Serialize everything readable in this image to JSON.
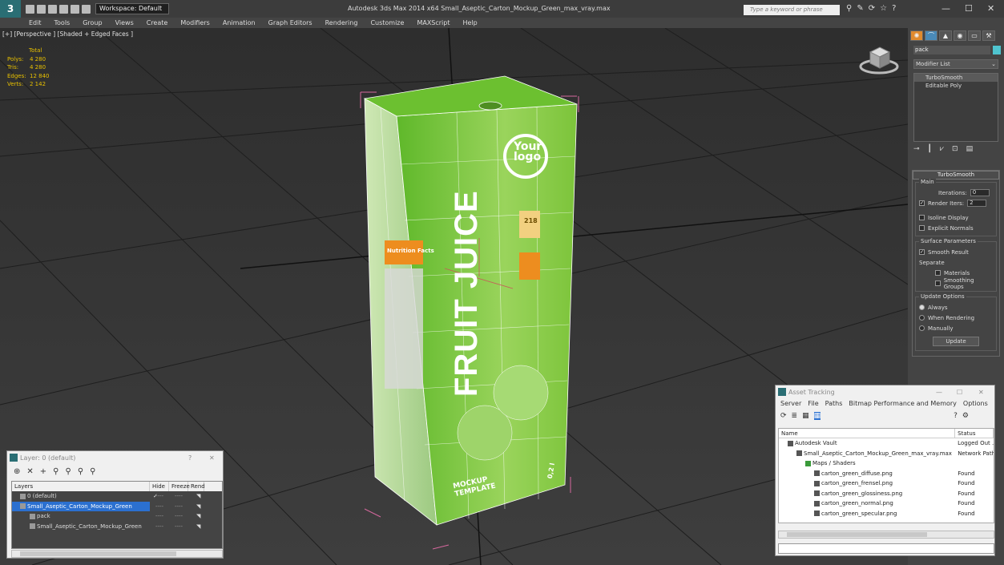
{
  "app": {
    "logo": "3",
    "workspace": "Workspace: Default",
    "title": "Autodesk 3ds Max  2014 x64     Small_Aseptic_Carton_Mockup_Green_max_vray.max",
    "search_placeholder": "Type a keyword or phrase"
  },
  "menu": [
    "Edit",
    "Tools",
    "Group",
    "Views",
    "Create",
    "Modifiers",
    "Animation",
    "Graph Editors",
    "Rendering",
    "Customize",
    "MAXScript",
    "Help"
  ],
  "viewport": {
    "label": "[+] [Perspective ] [Shaded + Edged Faces ]",
    "stats_header": "Total",
    "stats": [
      {
        "k": "Polys:",
        "v": "4 280"
      },
      {
        "k": "Tris:",
        "v": "4 280"
      },
      {
        "k": "Edges:",
        "v": "12 840"
      },
      {
        "k": "Verts:",
        "v": "2 142"
      }
    ],
    "carton": {
      "brand_text": "FRUIT JUICE",
      "logo_line1": "Your",
      "logo_line2": "logo",
      "badge": "Nutrition Facts",
      "kcal": "218",
      "mockup_line1": "MOCKUP",
      "mockup_line2": "TEMPLATE",
      "volume": "0,2 l"
    }
  },
  "command_panel": {
    "object_name": "pack",
    "modifier_list": "Modifier List",
    "stack": [
      "TurboSmooth",
      "Editable Poly"
    ],
    "rollout_title": "TurboSmooth",
    "main_group": "Main",
    "iterations_label": "Iterations:",
    "iterations_value": "0",
    "render_iters_label": "Render Iters:",
    "render_iters_value": "2",
    "isoline": "Isoline Display",
    "explicit_normals": "Explicit Normals",
    "surface_group": "Surface Parameters",
    "smooth_result": "Smooth Result",
    "separate": "Separate",
    "materials": "Materials",
    "smoothing_groups": "Smoothing Groups",
    "update_group": "Update Options",
    "always": "Always",
    "when_rendering": "When Rendering",
    "manually": "Manually",
    "update_button": "Update"
  },
  "layer_manager": {
    "title": "Layer: 0 (default)",
    "help": "?",
    "close": "✕",
    "columns": [
      "Layers",
      "Hide",
      "Freeze",
      "Rend"
    ],
    "rows": [
      {
        "label": "0 (default)",
        "indent": 0,
        "selected": false,
        "check": "✓"
      },
      {
        "label": "Small_Aseptic_Carton_Mockup_Green",
        "indent": 0,
        "selected": true,
        "check": ""
      },
      {
        "label": "pack",
        "indent": 1,
        "selected": false,
        "check": ""
      },
      {
        "label": "Small_Aseptic_Carton_Mockup_Green",
        "indent": 1,
        "selected": false,
        "check": ""
      }
    ],
    "dash": "----"
  },
  "asset_tracking": {
    "title": "Asset Tracking",
    "menus": [
      "Server",
      "File",
      "Paths",
      "Bitmap Performance and Memory",
      "Options"
    ],
    "columns": [
      "Name",
      "Status"
    ],
    "rows": [
      {
        "name": "Autodesk Vault",
        "status": "Logged Out ...",
        "indent": 1
      },
      {
        "name": "Small_Aseptic_Carton_Mockup_Green_max_vray.max",
        "status": "Network Path",
        "indent": 2
      },
      {
        "name": "Maps / Shaders",
        "status": "",
        "indent": 3
      },
      {
        "name": "carton_green_diffuse.png",
        "status": "Found",
        "indent": 4
      },
      {
        "name": "carton_green_frensel.png",
        "status": "Found",
        "indent": 4
      },
      {
        "name": "carton_green_glossiness.png",
        "status": "Found",
        "indent": 4
      },
      {
        "name": "carton_green_normal.png",
        "status": "Found",
        "indent": 4
      },
      {
        "name": "carton_green_specular.png",
        "status": "Found",
        "indent": 4
      }
    ]
  }
}
